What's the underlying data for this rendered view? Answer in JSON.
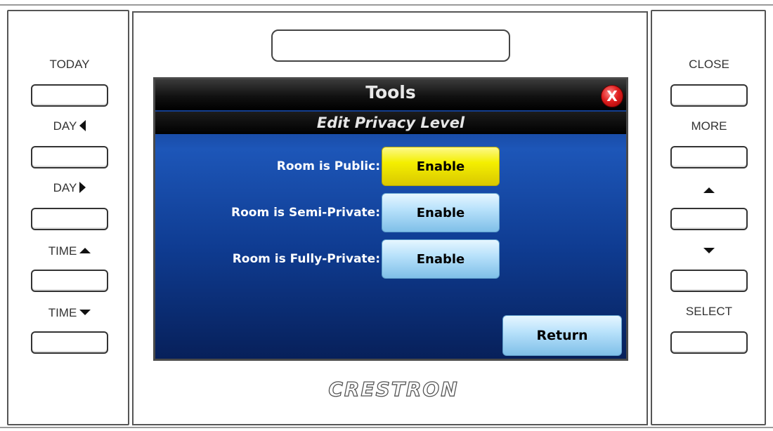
{
  "left_buttons": [
    {
      "label": "TODAY",
      "arrow": ""
    },
    {
      "label": "DAY",
      "arrow": "left-arrow"
    },
    {
      "label": "DAY",
      "arrow": "right-arrow"
    },
    {
      "label": "TIME",
      "arrow": "up-arrow"
    },
    {
      "label": "TIME",
      "arrow": "down-arrow"
    }
  ],
  "right_buttons": [
    {
      "label": "CLOSE",
      "arrow": ""
    },
    {
      "label": "MORE",
      "arrow": ""
    },
    {
      "label": "",
      "arrow": "up-arrow"
    },
    {
      "label": "",
      "arrow": "down-arrow"
    },
    {
      "label": "SELECT",
      "arrow": ""
    }
  ],
  "screen": {
    "title": "Tools",
    "close_icon": "X",
    "subtitle": "Edit Privacy Level",
    "options": [
      {
        "label": "Room is Public:",
        "button": "Enable",
        "state": "active"
      },
      {
        "label": "Room is Semi-Private:",
        "button": "Enable",
        "state": "inactive"
      },
      {
        "label": "Room is Fully-Private:",
        "button": "Enable",
        "state": "inactive"
      }
    ],
    "return_label": "Return"
  },
  "brand": "CRESTRON",
  "colors": {
    "active_button": "#f4ef00",
    "inactive_button": "#b9e2fb",
    "screen_background": "#1d56b8",
    "title_bar": "#111111",
    "close_button": "#e02020"
  }
}
